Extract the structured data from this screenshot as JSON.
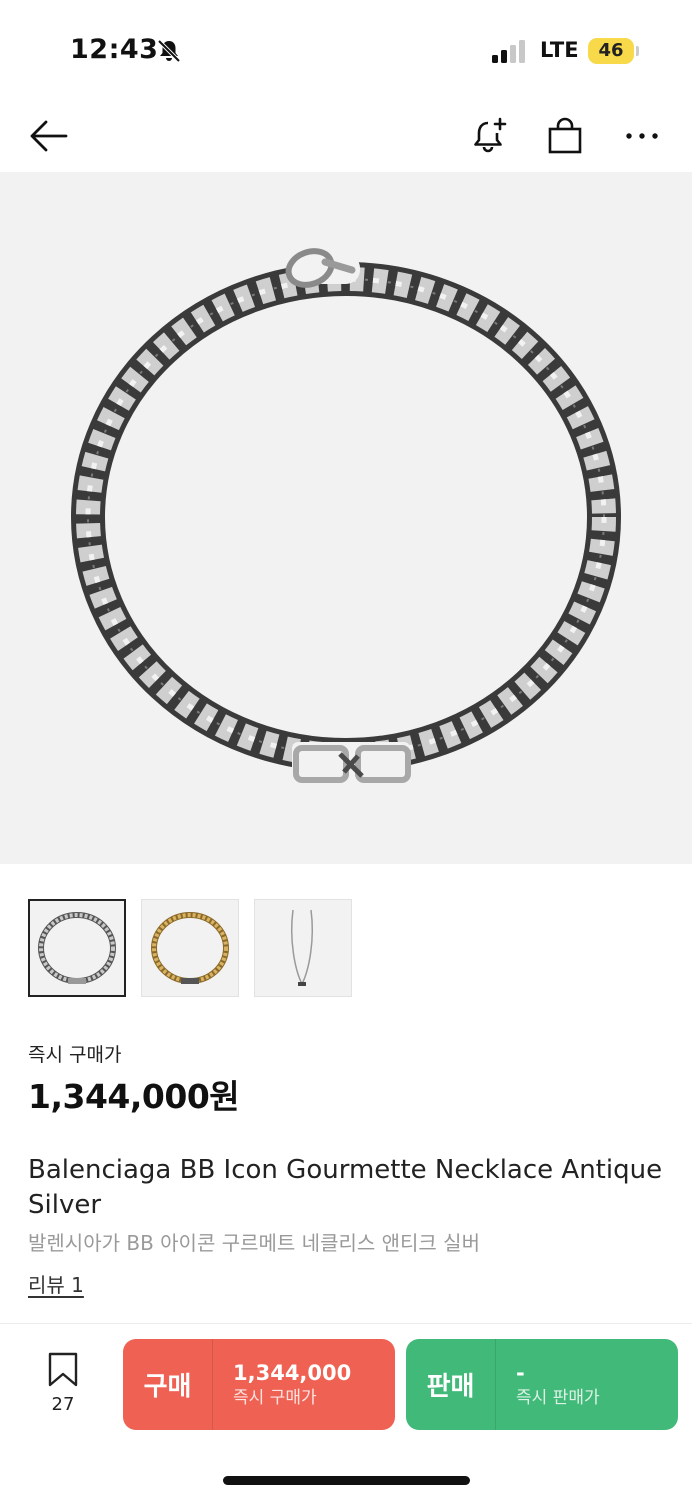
{
  "status_bar": {
    "time": "12:43",
    "network": "LTE",
    "battery": "46",
    "icons": [
      "bell-off-icon",
      "signal-icon",
      "battery-icon"
    ]
  },
  "nav": {
    "icons": [
      "back-arrow-icon",
      "bell-plus-icon",
      "shopping-bag-icon",
      "more-icon"
    ]
  },
  "product": {
    "price_label": "즉시 구매가",
    "price": "1,344,000원",
    "title": "Balenciaga BB Icon Gourmette Necklace Antique Silver",
    "subtitle": "발렌시아가 BB 아이콘 구르메트 네클리스 앤티크 실버",
    "review_link": "리뷰 1"
  },
  "bottom_bar": {
    "wish_count": "27",
    "buy": {
      "label": "구매",
      "price": "1,344,000",
      "sub": "즉시 구매가"
    },
    "sell": {
      "label": "판매",
      "price": "-",
      "sub": "즉시 판매가"
    }
  },
  "colors": {
    "buy": "#ef6253",
    "sell": "#41b979",
    "battery": "#f7d94a",
    "image_bg": "#f2f2f2"
  }
}
